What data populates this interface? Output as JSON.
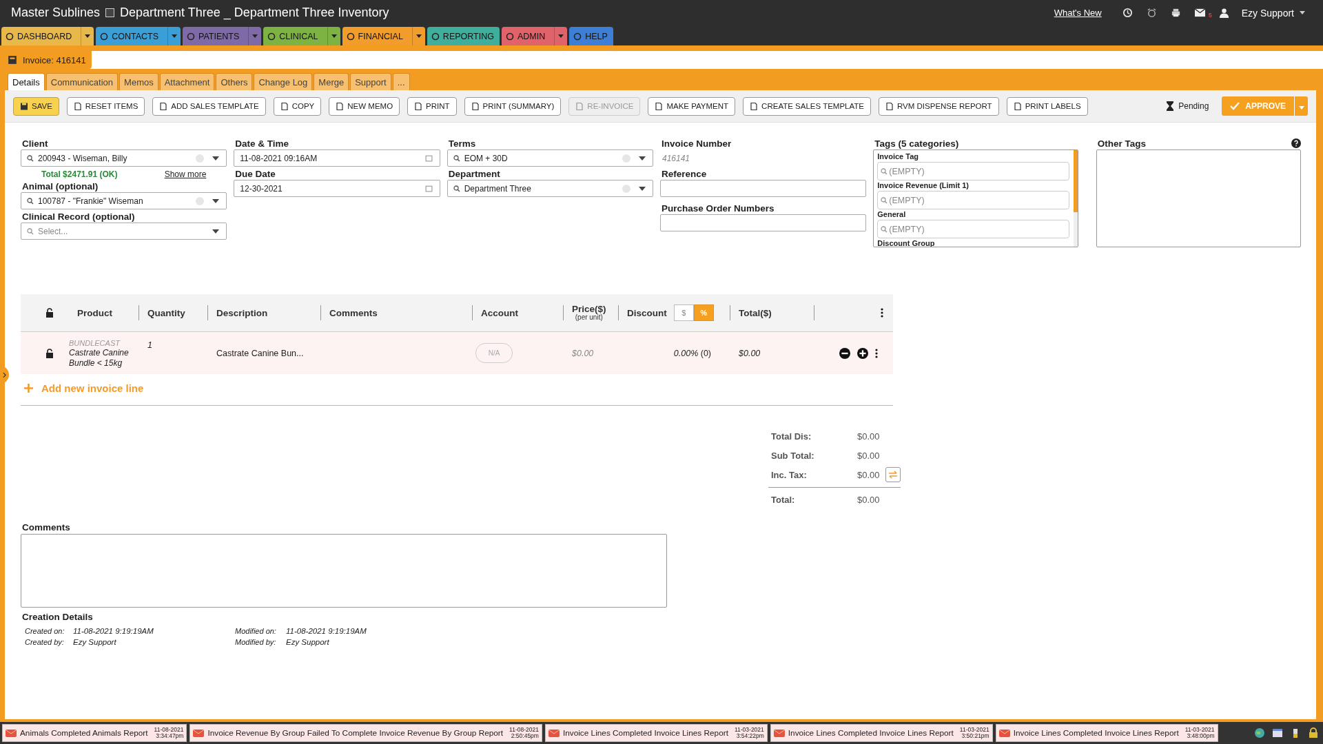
{
  "window": {
    "app": "Master Sublines",
    "title": "Department Three _ Department Three Inventory"
  },
  "header": {
    "whats_new": "What's New",
    "mail_badge": "5",
    "user": "Ezy Support"
  },
  "nav": [
    {
      "label": "DASHBOARD",
      "color": "#e8b94a",
      "has_menu": true
    },
    {
      "label": "CONTACTS",
      "color": "#3a9fd6",
      "has_menu": true
    },
    {
      "label": "PATIENTS",
      "color": "#7d6aa6",
      "has_menu": true
    },
    {
      "label": "CLINICAL",
      "color": "#7db343",
      "has_menu": true
    },
    {
      "label": "FINANCIAL",
      "color": "#f29c2b",
      "has_menu": true
    },
    {
      "label": "REPORTING",
      "color": "#3fae9c",
      "has_menu": false
    },
    {
      "label": "ADMIN",
      "color": "#e0626a",
      "has_menu": true
    },
    {
      "label": "HELP",
      "color": "#3d7fd6",
      "has_menu": false
    }
  ],
  "document_tab": {
    "label": "Invoice: 416141"
  },
  "tabs": [
    {
      "label": "Details",
      "selected": true
    },
    {
      "label": "Communication",
      "selected": false
    },
    {
      "label": "Memos",
      "selected": false
    },
    {
      "label": "Attachment",
      "selected": false
    },
    {
      "label": "Others",
      "selected": false
    },
    {
      "label": "Change Log",
      "selected": false
    },
    {
      "label": "Merge",
      "selected": false
    },
    {
      "label": "Support",
      "selected": false
    },
    {
      "label": "...",
      "selected": false
    }
  ],
  "toolbar": [
    {
      "label": "SAVE",
      "kind": "save",
      "disabled": false
    },
    {
      "label": "RESET ITEMS",
      "kind": "normal",
      "disabled": false
    },
    {
      "label": "ADD SALES TEMPLATE",
      "kind": "normal",
      "disabled": false
    },
    {
      "label": "COPY",
      "kind": "normal",
      "disabled": false
    },
    {
      "label": "NEW MEMO",
      "kind": "normal",
      "disabled": false
    },
    {
      "label": "PRINT",
      "kind": "normal",
      "disabled": false
    },
    {
      "label": "PRINT (SUMMARY)",
      "kind": "normal",
      "disabled": false
    },
    {
      "label": "RE-INVOICE",
      "kind": "normal",
      "disabled": true
    },
    {
      "label": "MAKE PAYMENT",
      "kind": "normal",
      "disabled": false
    },
    {
      "label": "CREATE SALES TEMPLATE",
      "kind": "normal",
      "disabled": false
    },
    {
      "label": "RVM DISPENSE REPORT",
      "kind": "normal",
      "disabled": false
    },
    {
      "label": "PRINT LABELS",
      "kind": "normal",
      "disabled": false
    }
  ],
  "status": "Pending",
  "approve": "APPROVE",
  "form": {
    "client": {
      "label": "Client",
      "value": "200943 - Wiseman, Billy",
      "total": "Total $2471.91 (OK)",
      "show_more": "Show more"
    },
    "animal": {
      "label": "Animal (optional)",
      "value": "100787 - \"Frankie\" Wiseman"
    },
    "clinical_record": {
      "label": "Clinical Record (optional)",
      "placeholder": "Select..."
    },
    "date_time": {
      "label": "Date & Time",
      "value": "11-08-2021 09:16AM"
    },
    "due_date": {
      "label": "Due Date",
      "value": "12-30-2021"
    },
    "terms": {
      "label": "Terms",
      "value": "EOM + 30D"
    },
    "department": {
      "label": "Department",
      "value": "Department Three"
    },
    "invoice_number": {
      "label": "Invoice Number",
      "value": "416141"
    },
    "reference": {
      "label": "Reference"
    },
    "purchase_order_numbers": {
      "label": "Purchase Order Numbers"
    }
  },
  "tags": {
    "title": "Tags (5 categories)",
    "categories": [
      {
        "name": "Invoice Tag",
        "placeholder": "(EMPTY)"
      },
      {
        "name": "Invoice Revenue (Limit 1)",
        "placeholder": "(EMPTY)"
      },
      {
        "name": "General",
        "placeholder": "(EMPTY)"
      },
      {
        "name": "Discount Group"
      }
    ]
  },
  "other_tags": {
    "title": "Other Tags"
  },
  "table": {
    "columns": [
      {
        "label": "Product",
        "kind": "plain"
      },
      {
        "label": "Quantity",
        "kind": "plain"
      },
      {
        "label": "Description",
        "kind": "plain"
      },
      {
        "label": "Comments",
        "kind": "plain"
      },
      {
        "label": "Account",
        "kind": "plain"
      },
      {
        "label": "Price($)",
        "sub": "(per unit)",
        "kind": "sub"
      },
      {
        "label": "Discount",
        "kind": "toggle"
      },
      {
        "label": "Total($)",
        "kind": "plain"
      }
    ],
    "discount_modes": [
      {
        "label": "$",
        "selected": false
      },
      {
        "label": "%",
        "selected": true
      }
    ],
    "rows": [
      {
        "code": "BUNDLECAST",
        "product": "Castrate Canine Bundle < 15kg",
        "quantity": "1",
        "description": "Castrate Canine Bun...",
        "account": "N/A",
        "price": "$0.00",
        "discount": "0.00%",
        "discount_count": "(0)",
        "total": "$0.00"
      }
    ],
    "add_line": "Add new invoice line"
  },
  "totals": [
    {
      "label": "Total Dis:",
      "value": "$0.00",
      "kind": "plain"
    },
    {
      "label": "Sub Total:",
      "value": "$0.00",
      "kind": "plain"
    },
    {
      "label": "Inc. Tax:",
      "value": "$0.00",
      "kind": "tax"
    },
    {
      "label": "Total:",
      "value": "$0.00",
      "kind": "grand"
    }
  ],
  "comments": {
    "label": "Comments"
  },
  "creation": {
    "title": "Creation Details",
    "fields": [
      {
        "label": "Created on:",
        "value": "11-08-2021 9:19:19AM"
      },
      {
        "label": "Modified on:",
        "value": "11-08-2021 9:19:19AM"
      },
      {
        "label": "Created by:",
        "value": "Ezy Support"
      },
      {
        "label": "Modified by:",
        "value": "Ezy Support"
      }
    ]
  },
  "taskbar": [
    {
      "title": "Animals Completed Animals Report",
      "date": "11-08-2021",
      "time": "3:34:47pm"
    },
    {
      "title": "Invoice Revenue By Group Failed To Complete Invoice Revenue By Group Report",
      "date": "11-08-2021",
      "time": "2:50:45pm"
    },
    {
      "title": "Invoice Lines Completed Invoice Lines Report",
      "date": "11-03-2021",
      "time": "3:54:22pm"
    },
    {
      "title": "Invoice Lines Completed Invoice Lines Report",
      "date": "11-03-2021",
      "time": "3:50:21pm"
    },
    {
      "title": "Invoice Lines Completed Invoice Lines Report",
      "date": "11-03-2021",
      "time": "3:48:00pm"
    }
  ]
}
